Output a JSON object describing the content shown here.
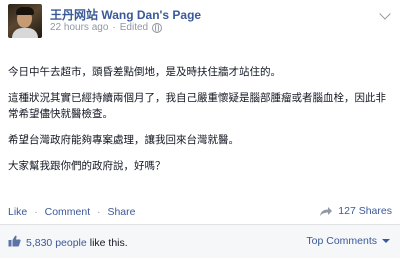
{
  "post": {
    "page_name": "王丹网站 Wang Dan's Page",
    "time": "22 hours ago",
    "meta_sep": "·",
    "edited": "Edited",
    "paragraphs": [
      "今日中午去超市，頭昏差點倒地，是及時扶住牆才站住的。",
      "這種狀況其實已經持續兩個月了，我自己嚴重懷疑是腦部腫瘤或者腦血栓，因此非常希望儘快就醫檢查。",
      "希望台灣政府能夠專案處理，讓我回來台灣就醫。",
      "大家幫我跟你們的政府說，好嗎？"
    ]
  },
  "actions": {
    "like": "Like",
    "comment": "Comment",
    "share": "Share",
    "sep": "·",
    "shares_count": "127 Shares"
  },
  "footer": {
    "likes_count": "5,830 people",
    "likes_rest": "like this.",
    "top_comments": "Top Comments"
  },
  "colors": {
    "link": "#3b5998",
    "meta": "#9197a3",
    "footer_bg": "#f6f7f8"
  }
}
